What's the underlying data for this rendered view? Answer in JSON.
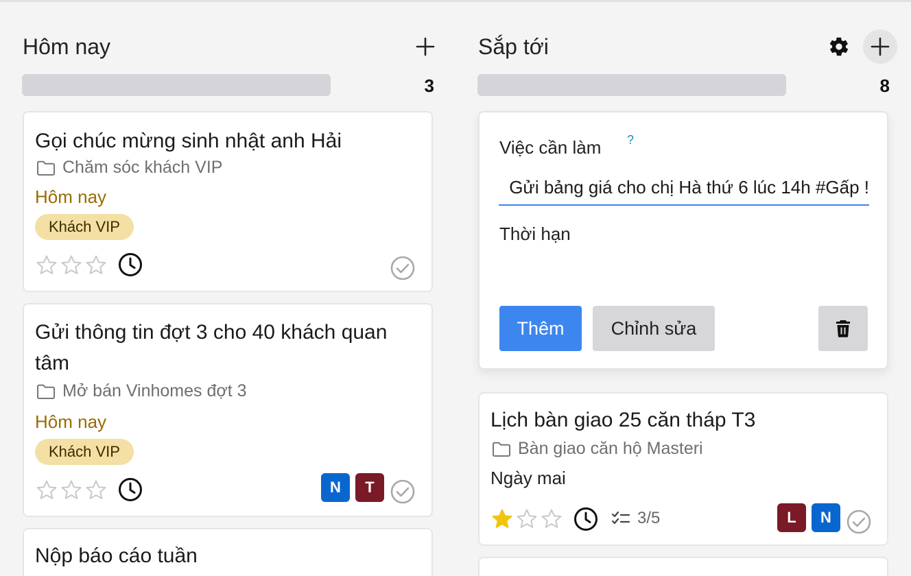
{
  "columns": {
    "today": {
      "title": "Hôm nay",
      "count": "3",
      "cards": [
        {
          "title": "Gọi chúc mừng sinh nhật anh Hải",
          "folder": "Chăm sóc khách VIP",
          "due": "Hôm nay",
          "tag": "Khách VIP",
          "stars": 0
        },
        {
          "title": "Gửi thông tin đợt 3 cho 40 khách quan tâm",
          "folder": "Mở bán Vinhomes đợt 3",
          "due": "Hôm nay",
          "tag": "Khách VIP",
          "stars": 0,
          "avatars": [
            "N",
            "T"
          ]
        },
        {
          "title": "Nộp báo cáo tuần"
        }
      ]
    },
    "upcoming": {
      "title": "Sắp tới",
      "count": "8",
      "form": {
        "task_label": "Việc cần làm",
        "help": "?",
        "task_value": "Gửi bảng giá cho chị Hà thứ 6 lúc 14h #Gấp !",
        "deadline_label": "Thời hạn",
        "add_label": "Thêm",
        "edit_label": "Chỉnh sửa"
      },
      "cards": [
        {
          "title": "Lịch bàn giao 25 căn tháp T3",
          "folder": "Bàn giao căn hộ Masteri",
          "due": "Ngày mai",
          "stars": 1,
          "subtasks": "3/5",
          "avatars": [
            "L",
            "N"
          ]
        }
      ]
    }
  },
  "colors": {
    "accent": "#3d86f0",
    "due_today": "#9a6b00",
    "tag_bg": "#f4dfa4",
    "star_filled": "#f2c40f",
    "avatar_blue": "#0a66cf",
    "avatar_red": "#7a1a26"
  },
  "icons": [
    "plus-icon",
    "gear-icon",
    "folder-icon",
    "star-icon",
    "clock-icon",
    "check-circle-icon",
    "checklist-icon",
    "trash-icon"
  ]
}
